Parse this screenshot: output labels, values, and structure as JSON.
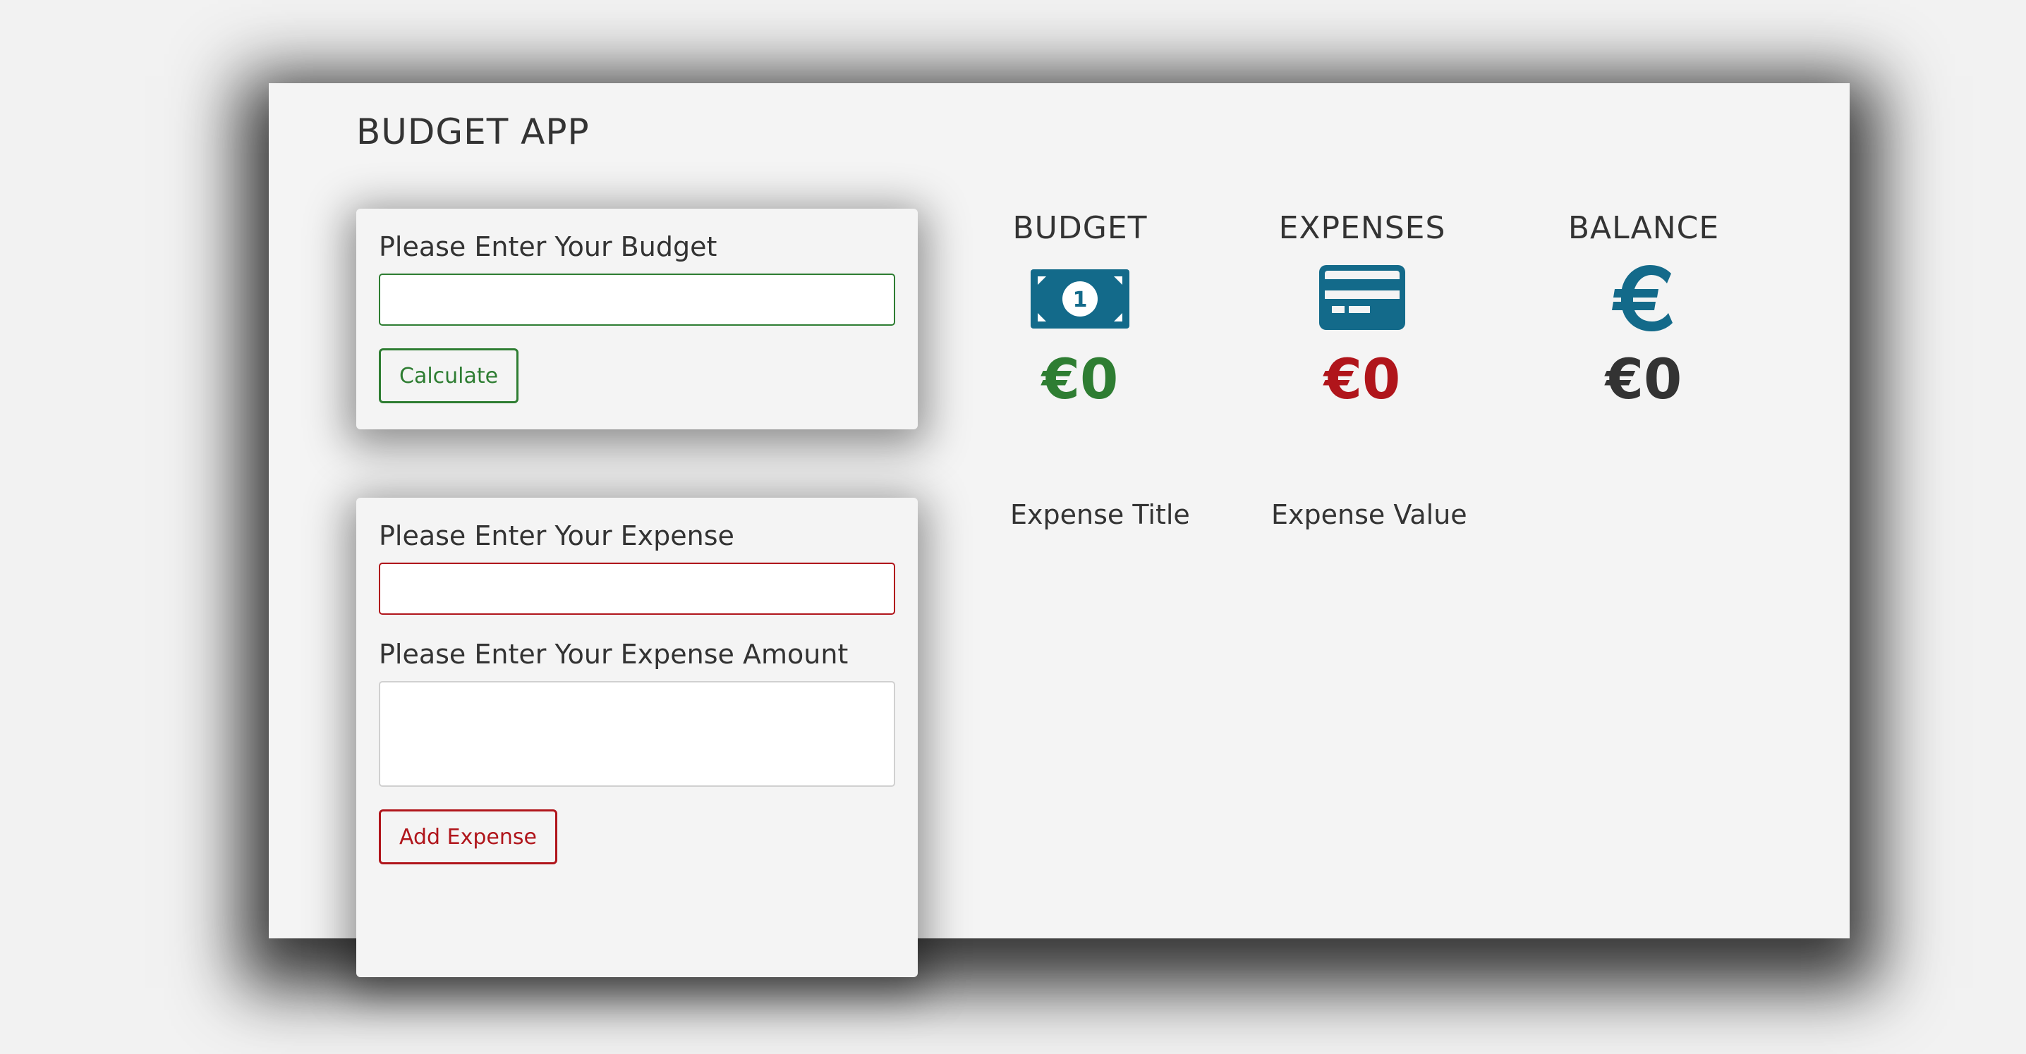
{
  "app": {
    "title": "BUDGET APP"
  },
  "budget_form": {
    "label": "Please Enter Your Budget",
    "input_value": "",
    "button_label": "Calculate"
  },
  "expense_form": {
    "title_label": "Please Enter Your Expense",
    "title_value": "",
    "amount_label": "Please Enter Your Expense Amount",
    "amount_value": "",
    "button_label": "Add Expense"
  },
  "summary": {
    "budget": {
      "label": "BUDGET",
      "icon": "banknote-icon",
      "value": "€0",
      "color": "#2e7d32"
    },
    "expenses": {
      "label": "EXPENSES",
      "icon": "credit-card-icon",
      "value": "€0",
      "color": "#b0151b"
    },
    "balance": {
      "label": "BALANCE",
      "icon": "euro-icon",
      "value": "€0",
      "color": "#333333"
    },
    "icon_color": "#136a8a"
  },
  "expense_list": {
    "columns": [
      "Expense Title",
      "Expense Value"
    ]
  }
}
